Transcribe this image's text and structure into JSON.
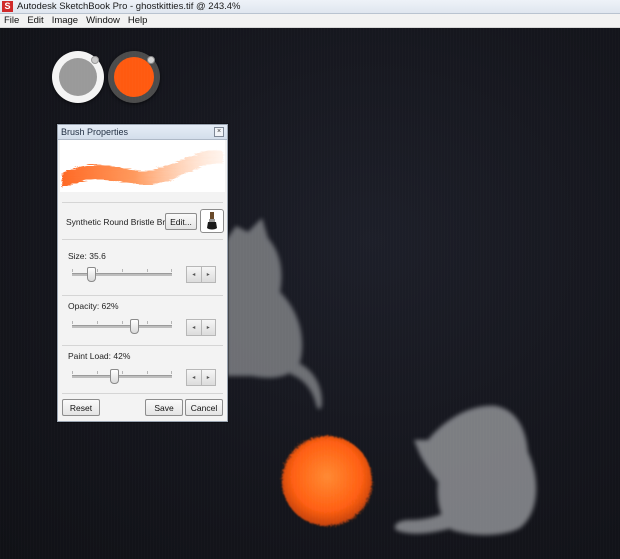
{
  "window": {
    "app_icon_letter": "S",
    "title": "Autodesk SketchBook Pro - ghostkitties.tif @ 243.4%"
  },
  "menu": [
    "File",
    "Edit",
    "Image",
    "Window",
    "Help"
  ],
  "colors": {
    "primary_puck": "#9a9a9a",
    "secondary_puck": "#ff5a10",
    "yarn_ball": "#ff6a1a"
  },
  "brush_panel": {
    "title": "Brush Properties",
    "close_glyph": "×",
    "brush_name": "Synthetic Round Bristle Brush",
    "edit_label": "Edit...",
    "sliders": [
      {
        "label": "Size: 35.6",
        "value": 0.19,
        "left_glyph": "◂",
        "right_glyph": "▸"
      },
      {
        "label": "Opacity: 62%",
        "value": 0.62,
        "left_glyph": "◂",
        "right_glyph": "▸"
      },
      {
        "label": "Paint Load: 42%",
        "value": 0.42,
        "left_glyph": "◂",
        "right_glyph": "▸"
      }
    ],
    "reset_label": "Reset",
    "save_label": "Save",
    "cancel_label": "Cancel"
  },
  "icons": {
    "app": "sketchbook-logo-icon",
    "brush": "paintbrush-icon",
    "close": "close-icon"
  }
}
